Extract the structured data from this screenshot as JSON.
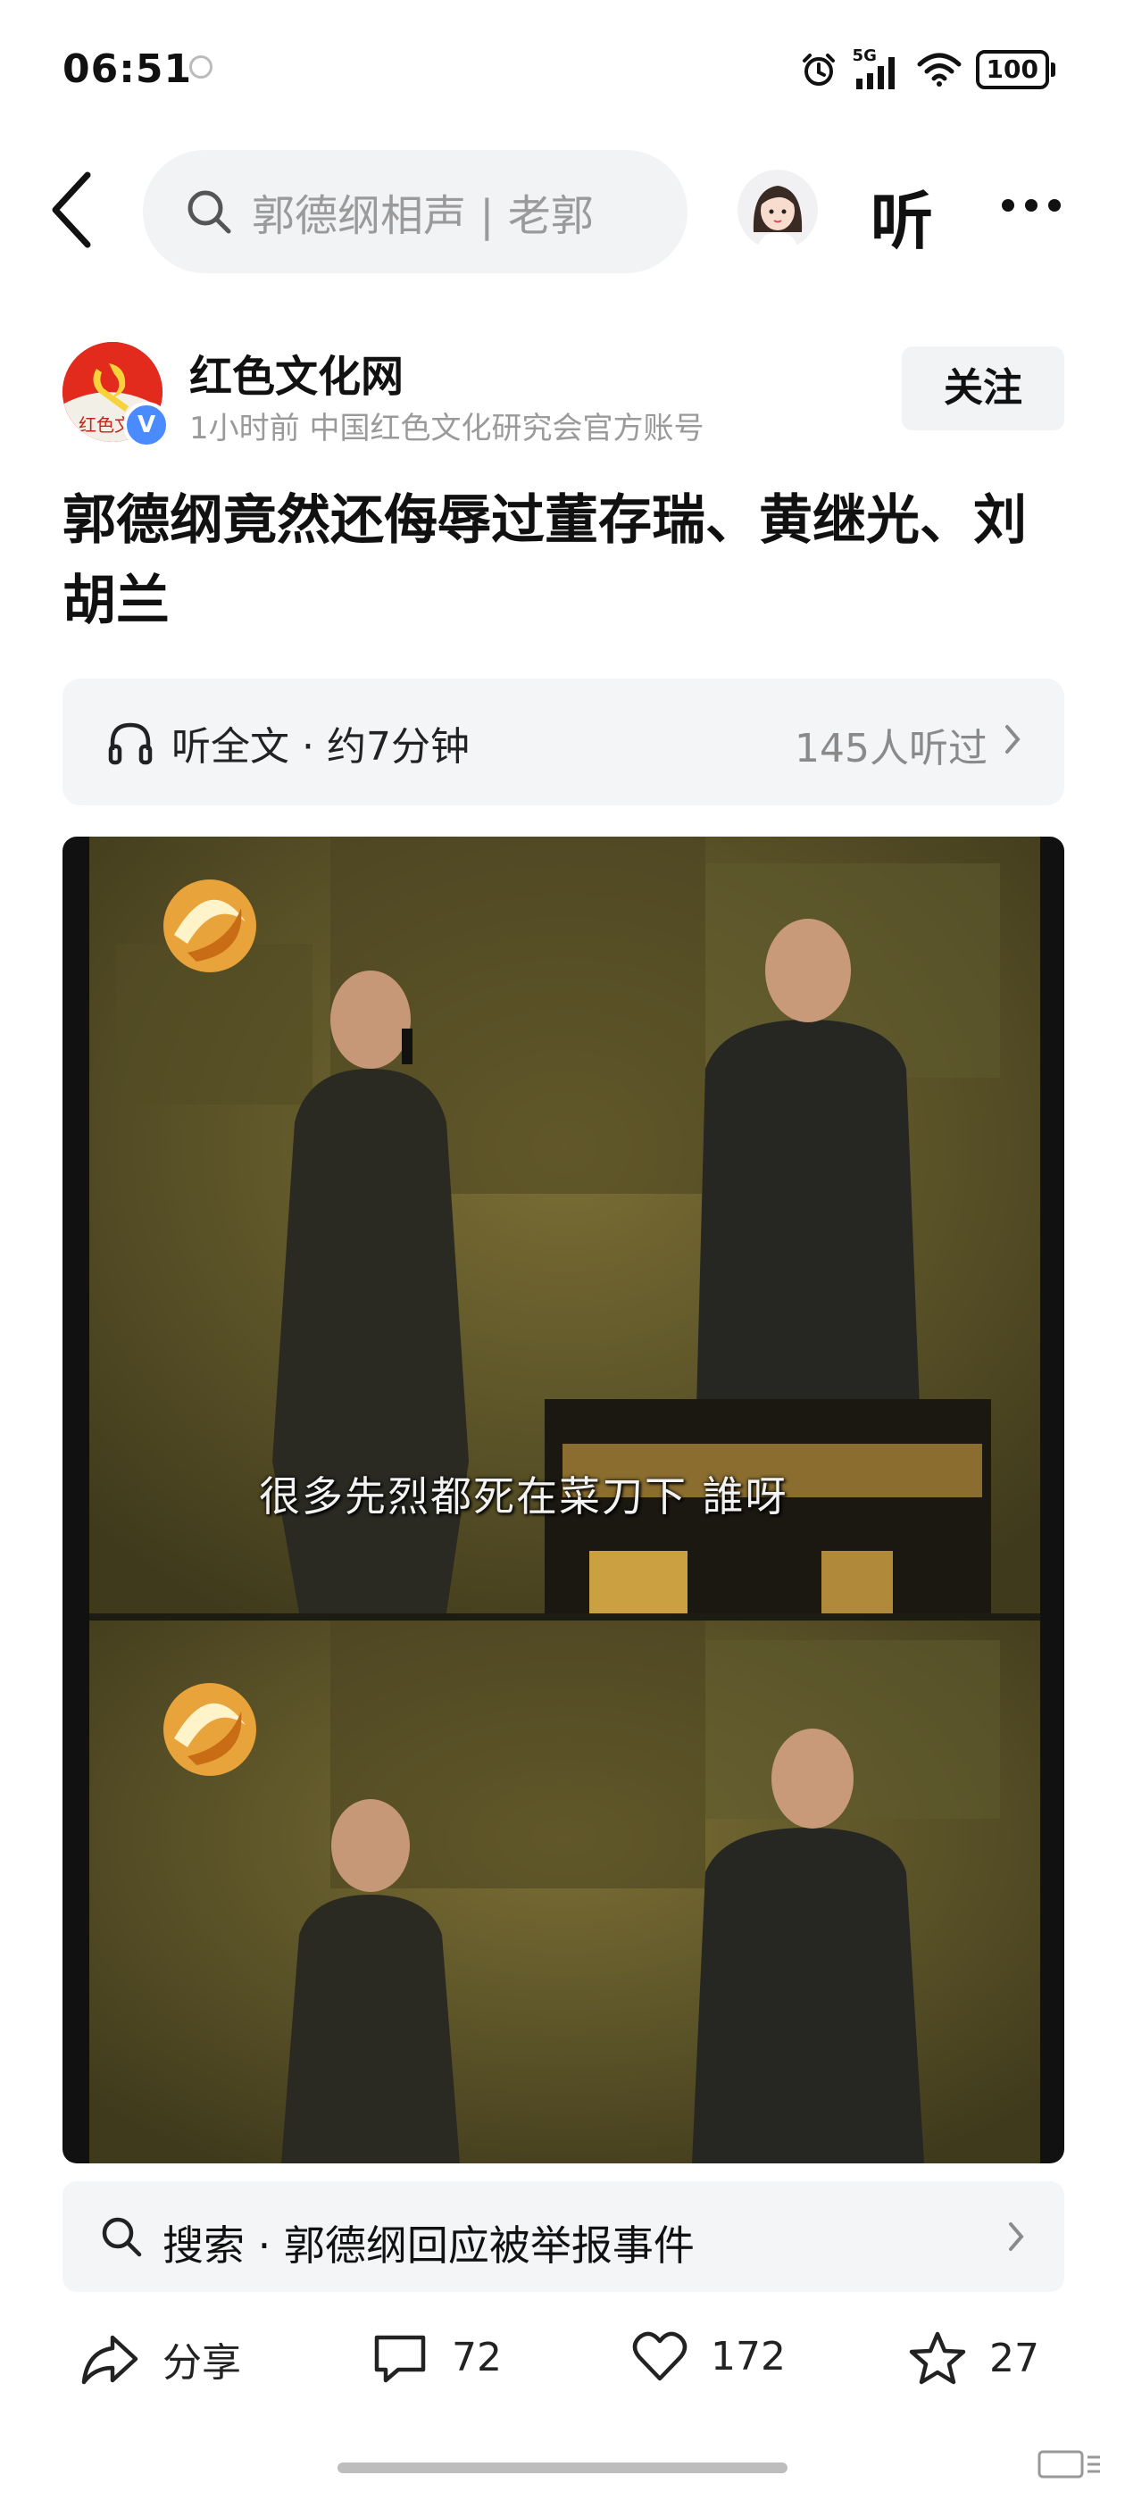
{
  "status_bar": {
    "time": "06:51",
    "network": "5G",
    "battery": "100"
  },
  "nav": {
    "search_placeholder": "郭德纲相声 | 老郭",
    "listen_label": "听"
  },
  "author": {
    "name": "红色文化网",
    "meta": "1小时前   中国红色文化研究会官方账号",
    "avatar_text": "红色文",
    "follow_label": "关注"
  },
  "article": {
    "title": "郭德纲竟然还侮辱过董存瑞、黄继光、刘胡兰"
  },
  "audio": {
    "label": "听全文 · 约7分钟",
    "listeners": "145人听过"
  },
  "media": {
    "subtitle": "很多先烈都死在菜刀下 誰呀"
  },
  "suggestion": {
    "text": "搜索 · 郭德纲回应被举报事件"
  },
  "actions": {
    "share": "分享",
    "comments": "72",
    "likes": "172",
    "favorites": "27"
  },
  "colors": {
    "brand_red": "#cf1b1b",
    "verify_blue": "#4a8cff",
    "gray_text": "#9a9a9a",
    "panel_bg": "#f4f5f7"
  }
}
